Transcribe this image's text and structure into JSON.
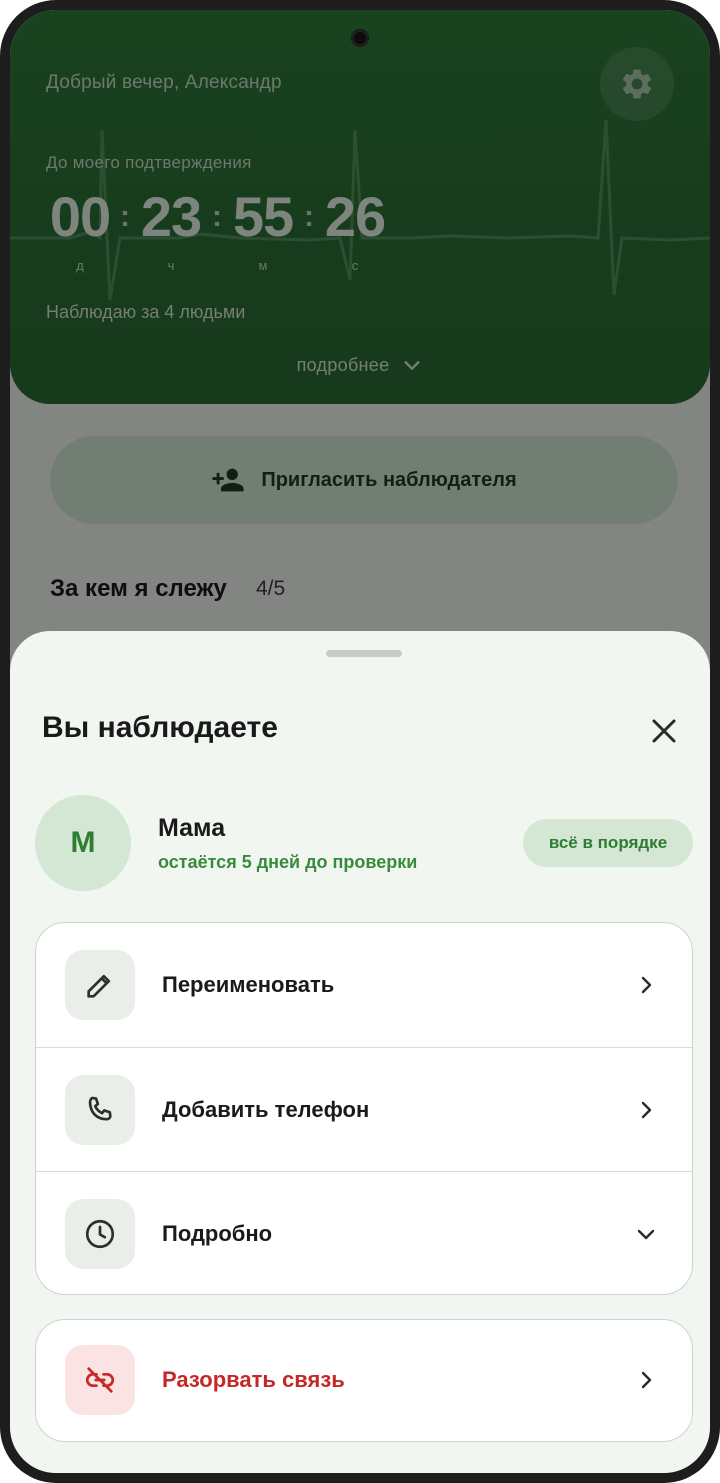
{
  "header": {
    "greeting": "Добрый вечер, Александр",
    "until_label": "До моего подтверждения",
    "timer": {
      "days": "00",
      "hours": "23",
      "minutes": "55",
      "seconds": "26",
      "days_label": "д",
      "hours_label": "ч",
      "minutes_label": "м",
      "seconds_label": "с"
    },
    "watching_text": "Наблюдаю за 4 людьми",
    "more_label": "подробнее"
  },
  "invite": {
    "label": "Пригласить наблюдателя"
  },
  "following": {
    "title": "За кем я слежу",
    "count": "4/5"
  },
  "sheet": {
    "title": "Вы наблюдаете",
    "person": {
      "initial": "М",
      "name": "Мама",
      "subtitle": "остаётся 5 дней до проверки",
      "status": "всё в порядке"
    },
    "actions": [
      {
        "label": "Переименовать",
        "icon": "pencil-icon",
        "chevron": "chevron-right-icon"
      },
      {
        "label": "Добавить телефон",
        "icon": "phone-icon",
        "chevron": "chevron-right-icon"
      },
      {
        "label": "Подробно",
        "icon": "clock-icon",
        "chevron": "chevron-down-icon"
      }
    ],
    "danger_action": {
      "label": "Разорвать связь",
      "icon": "link-off-icon",
      "chevron": "chevron-right-icon"
    }
  },
  "colors": {
    "header_green": "#2f7a3a",
    "accent_green": "#2e7d32",
    "badge_bg": "#d3e7d4",
    "danger_red": "#c62828",
    "sheet_bg": "#f1f6f1"
  }
}
